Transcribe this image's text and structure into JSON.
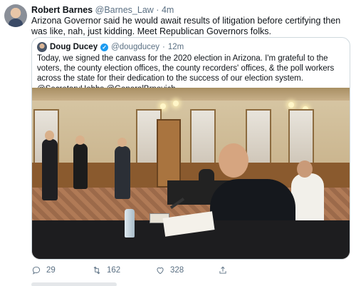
{
  "tweet": {
    "author_name": "Robert Barnes",
    "author_handle": "@Barnes_Law",
    "separator": "·",
    "time": "4m",
    "text": "Arizona Governor said he would await results of litigation before certifying then was like, nah, just kidding. Meet Republican Governors folks."
  },
  "quoted": {
    "author_name": "Doug Ducey",
    "author_handle": "@dougducey",
    "separator": "·",
    "time": "12m",
    "text": "Today, we signed the canvass for the 2020 election in Arizona. I'm grateful to the voters, the county election offices, the county recorders' offices, & the poll workers across the state for their dedication to the success of our election system. @SecretaryHobbs @GeneralBrnovich"
  },
  "actions": {
    "reply_count": "29",
    "retweet_count": "162",
    "like_count": "328"
  },
  "icons": {
    "reply": "reply-icon",
    "retweet": "retweet-icon",
    "like": "heart-icon",
    "share": "share-icon",
    "verified": "verified-badge-icon"
  },
  "colors": {
    "text": "#0f1419",
    "secondary": "#5b7083",
    "verified": "#1d9bf0",
    "border": "#cfd9de"
  }
}
